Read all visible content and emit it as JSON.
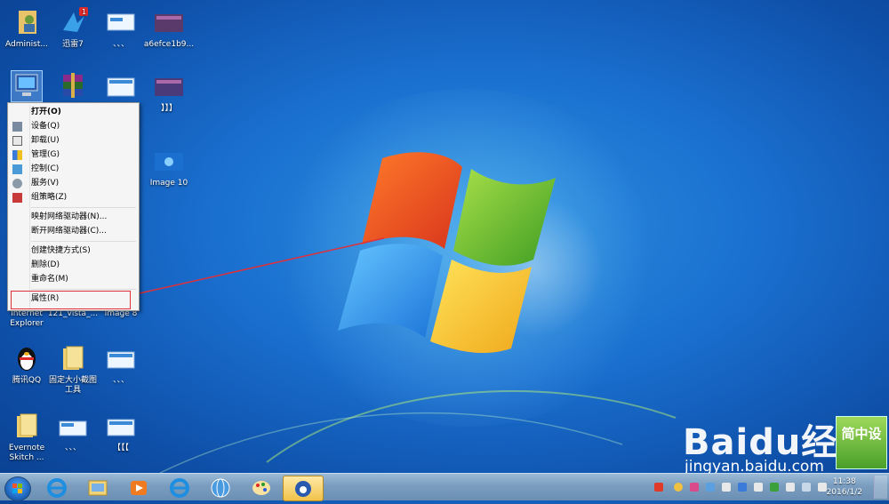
{
  "desktop_icons": [
    {
      "id": "administrator",
      "label": "Administ..."
    },
    {
      "id": "xunlei",
      "label": "迅雷7",
      "badge": "1"
    },
    {
      "id": "dots1",
      "label": "、、、"
    },
    {
      "id": "a6efce",
      "label": "a6efce1b9..."
    },
    {
      "id": "computer",
      "label": ""
    },
    {
      "id": "winrar",
      "label": ""
    },
    {
      "id": "img-thumb",
      "label": ""
    },
    {
      "id": "bracket",
      "label": "】】】"
    },
    {
      "id": "image10",
      "label": "Image 10"
    },
    {
      "id": "ie",
      "label": "Internet Explorer"
    },
    {
      "id": "vista",
      "label": "121_vista_..."
    },
    {
      "id": "image8",
      "label": "Image 8"
    },
    {
      "id": "qq",
      "label": "腾讯QQ"
    },
    {
      "id": "tool",
      "label": "固定大小截图工具"
    },
    {
      "id": "dots2",
      "label": "、、、"
    },
    {
      "id": "evernote",
      "label": "Evernote Skitch ..."
    },
    {
      "id": "dots3",
      "label": "、、、"
    },
    {
      "id": "bracket2",
      "label": "【【【"
    }
  ],
  "context_menu": {
    "open": "打开(O)",
    "device": "设备(Q)",
    "uninstall": "卸载(U)",
    "manage": "管理(G)",
    "control": "控制(C)",
    "service": "服务(V)",
    "group_policy": "组策略(Z)",
    "map_drive": "映射网络驱动器(N)...",
    "disconnect_drive": "断开网络驱动器(C)...",
    "create_shortcut": "创建快捷方式(S)",
    "delete": "删除(D)",
    "rename": "重命名(M)",
    "properties": "属性(R)"
  },
  "watermark": {
    "brand": "Baidu经验",
    "url": "jingyan.baidu.com",
    "corner": "简中设"
  },
  "taskbar": {
    "apps": [
      "ie",
      "explorer",
      "media-player",
      "ie-2",
      "globe",
      "paint",
      "baidu-app"
    ],
    "time": "11:38",
    "date": "2016/1/2"
  },
  "colors": {
    "accent": "#1a6fcf",
    "highlight": "#e0303a",
    "taskbar": "#7a9dbf"
  }
}
